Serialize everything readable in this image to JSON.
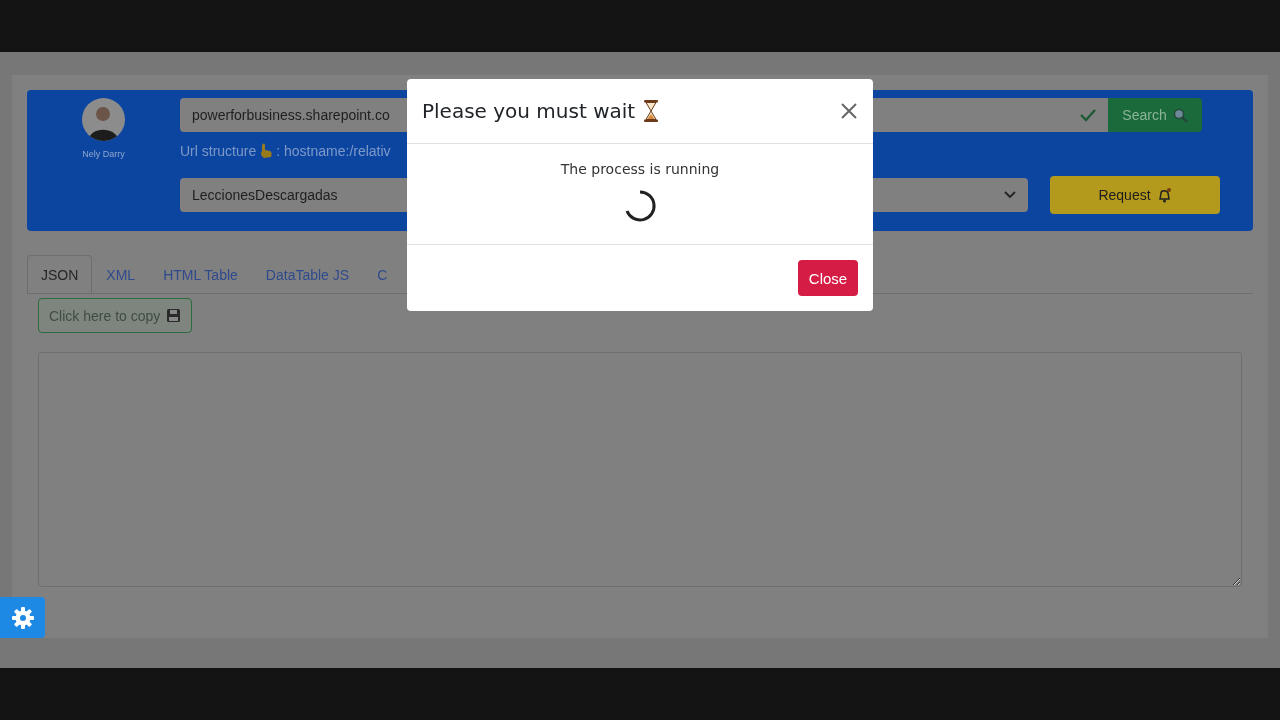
{
  "profile": {
    "name": "Nely Darry"
  },
  "url_field": {
    "value": "powerforbusiness.sharepoint.co",
    "valid": true
  },
  "search_button": {
    "label": "Search"
  },
  "url_hint": {
    "before": "Url structure",
    "after": ": hostname:/relativ"
  },
  "list_select": {
    "value": "LeccionesDescargadas"
  },
  "request_button": {
    "label": "Request"
  },
  "tabs": [
    {
      "label": "JSON",
      "selected": true
    },
    {
      "label": "XML",
      "selected": false
    },
    {
      "label": "HTML Table",
      "selected": false
    },
    {
      "label": "DataTable JS",
      "selected": false
    },
    {
      "label": "C",
      "selected": false
    }
  ],
  "copy_button": {
    "label": "Click here to copy"
  },
  "modal": {
    "title": "Please you must wait",
    "message": "The process is running",
    "close_label": "Close"
  }
}
